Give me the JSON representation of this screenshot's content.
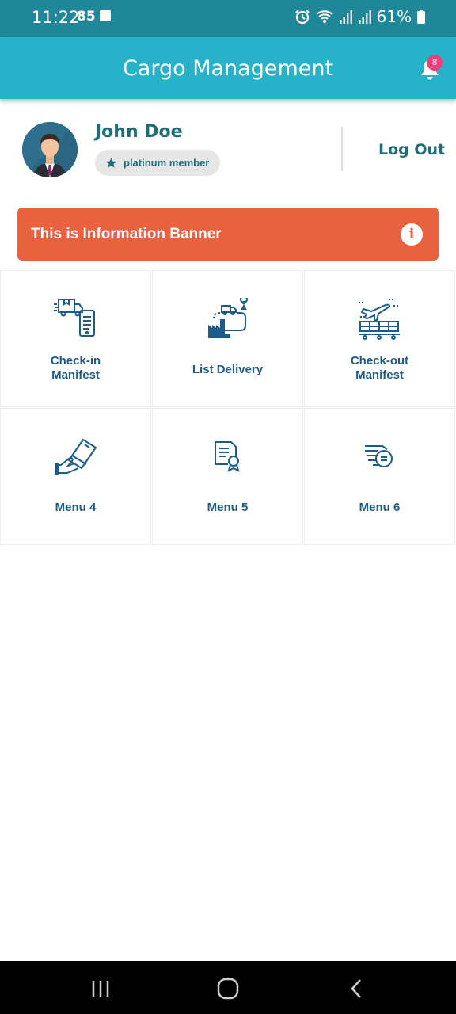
{
  "status_bar": {
    "time": "11:22",
    "badge_number": "85",
    "battery": "61%"
  },
  "app_bar": {
    "title": "Cargo Management",
    "notification_count": "8"
  },
  "profile": {
    "name": "John Doe",
    "membership": "platinum member",
    "logout_label": "Log Out"
  },
  "banner": {
    "text": "This is Information Banner"
  },
  "menu": [
    {
      "label": "Check-in\nManifest",
      "icon": "checkin-manifest-icon"
    },
    {
      "label": "List Delivery",
      "icon": "delivery-route-icon"
    },
    {
      "label": "Check-out\nManifest",
      "icon": "checkout-manifest-icon"
    },
    {
      "label": "Menu 4",
      "icon": "card-payment-icon"
    },
    {
      "label": "Menu 5",
      "icon": "certificate-icon"
    },
    {
      "label": "Menu 6",
      "icon": "fast-delivery-icon"
    }
  ],
  "colors": {
    "status_bar": "#1f8797",
    "app_bar": "#26b3c9",
    "banner": "#e8623f",
    "accent_text": "#1f6d78",
    "menu_text": "#1d5b8a"
  }
}
